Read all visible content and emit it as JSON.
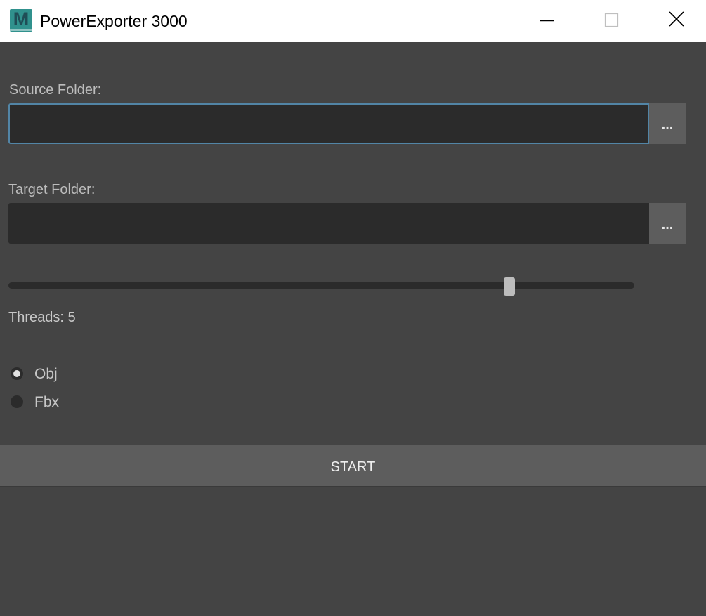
{
  "window": {
    "title": "PowerExporter 3000",
    "icon": "maya-app-icon",
    "icon_letter": "M",
    "controls": [
      "minimize-icon",
      "maximize-icon",
      "close-icon"
    ]
  },
  "source": {
    "label": "Source Folder:",
    "value": "",
    "browse_label": "..."
  },
  "target": {
    "label": "Target Folder:",
    "value": "",
    "browse_label": "..."
  },
  "threads": {
    "label": "Threads: 5",
    "value": 5,
    "slider_fraction": 0.8
  },
  "format": {
    "options": [
      {
        "label": "Obj",
        "checked": true
      },
      {
        "label": "Fbx",
        "checked": false
      }
    ]
  },
  "start_label": "START",
  "colors": {
    "background": "#444444",
    "field": "#2b2b2b",
    "button": "#5d5d5d",
    "focus_border": "#5285a6",
    "app_icon": "#30918d"
  }
}
